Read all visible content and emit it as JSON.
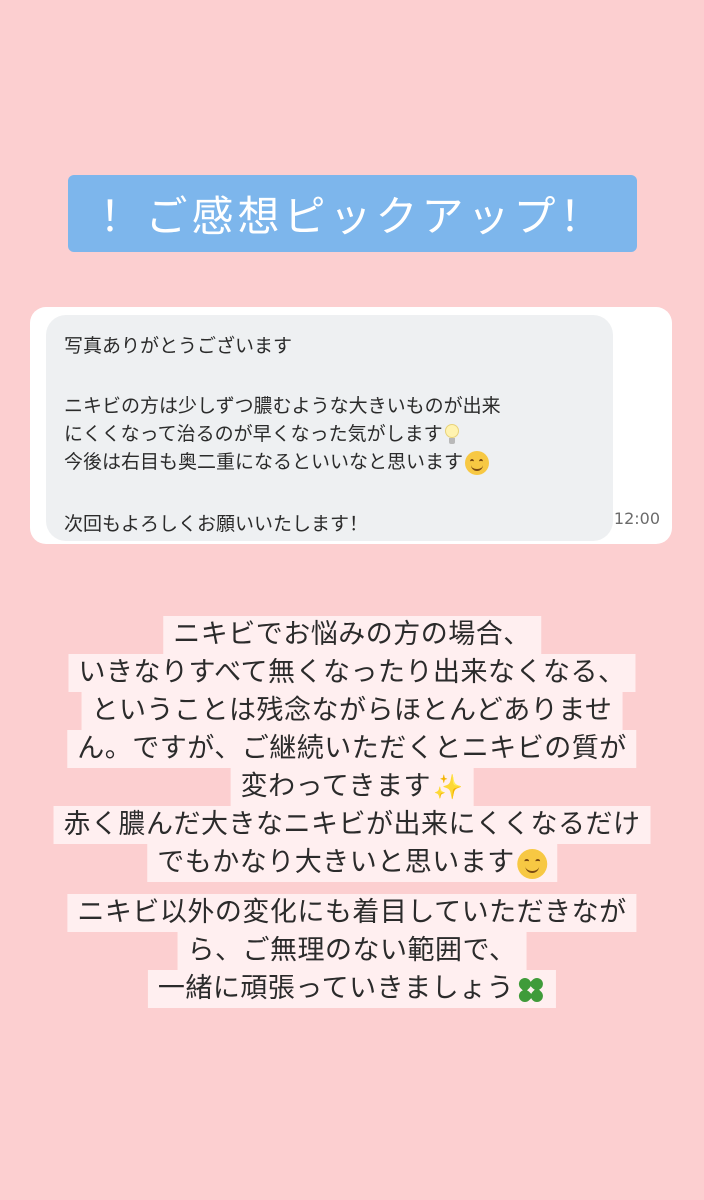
{
  "banner": {
    "title": "！ご感想ピックアップ！"
  },
  "chat": {
    "lines": [
      "写真ありがとうございます",
      "ニキビの方は少しずつ膿むような大きいものが出来",
      "にくくなって治るのが早くなった気がします",
      "今後は右目も奥二重になるといいなと思います",
      "次回もよろしくお願いいたします！"
    ],
    "timestamp": "12:00"
  },
  "caption": {
    "lines": [
      "ニキビでお悩みの方の場合、",
      "いきなりすべて無くなったり出来なくなる、",
      "ということは残念ながらほとんどありませ",
      "ん。ですが、ご継続いただくとニキビの質が",
      "変わってきます",
      "赤く膿んだ大きなニキビが出来にくくなるだけ",
      "でもかなり大きいと思います",
      "ニキビ以外の変化にも着目していただきなが",
      "ら、ご無理のない範囲で、",
      "一緒に頑張っていきましょう"
    ]
  },
  "icons": {
    "bulb": "light-bulb-icon",
    "smiley": "smiling-face-icon",
    "sparkles": "sparkles-icon",
    "clover": "four-leaf-clover-icon"
  },
  "colors": {
    "background": "#fccfd0",
    "banner": "#7db6ec",
    "bubble": "#eef0f2"
  }
}
